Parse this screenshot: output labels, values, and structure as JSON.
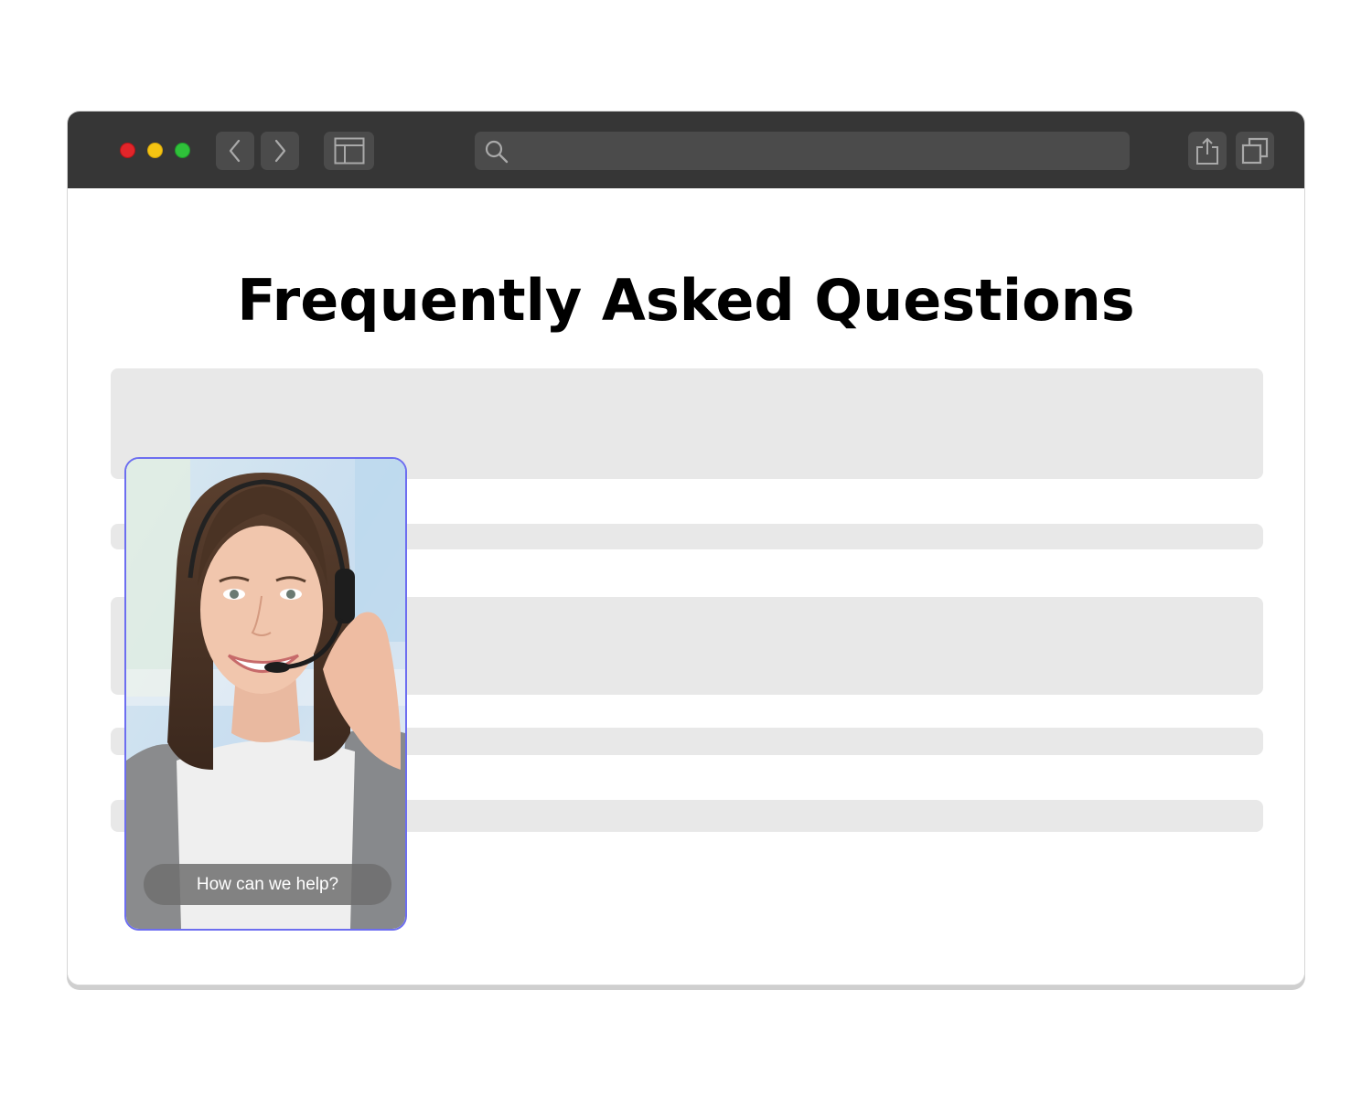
{
  "browser": {
    "address_value": "",
    "icons": [
      "chevron-left-icon",
      "chevron-right-icon",
      "sidebar-icon",
      "search-icon",
      "share-icon",
      "tabs-icon"
    ]
  },
  "page": {
    "title": "Frequently Asked Questions"
  },
  "widget": {
    "cta_label": "How can we help?",
    "accent_color": "#6d6ef0"
  }
}
